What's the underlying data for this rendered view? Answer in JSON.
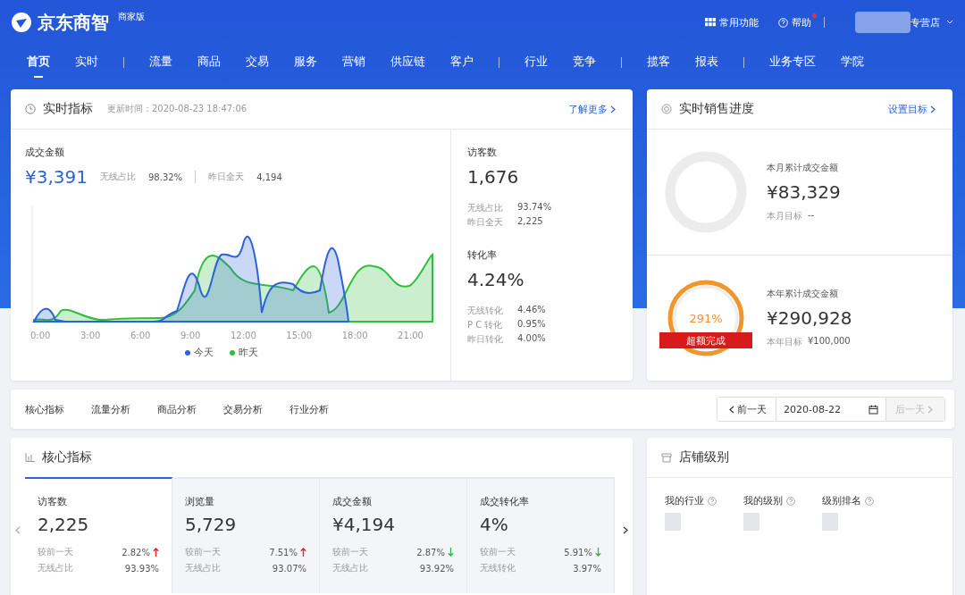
{
  "header": {
    "logo": "京东商智",
    "edition": "商家版",
    "tools": [
      {
        "kind": "apps",
        "label": "常用功能",
        "notice": false
      },
      {
        "kind": "help",
        "label": "帮助",
        "notice": true
      }
    ],
    "account_suffix": "专营店"
  },
  "nav": [
    [
      {
        "label": "首页",
        "selected": true
      },
      {
        "label": "实时",
        "selected": false
      }
    ],
    [
      {
        "label": "流量",
        "selected": false
      },
      {
        "label": "商品",
        "selected": false
      },
      {
        "label": "交易",
        "selected": false
      },
      {
        "label": "服务",
        "selected": false
      },
      {
        "label": "营销",
        "selected": false
      },
      {
        "label": "供应链",
        "selected": false
      },
      {
        "label": "客户",
        "selected": false
      }
    ],
    [
      {
        "label": "行业",
        "selected": false
      },
      {
        "label": "竞争",
        "selected": false
      }
    ],
    [
      {
        "label": "揽客",
        "selected": false
      },
      {
        "label": "报表",
        "selected": false
      }
    ],
    [
      {
        "label": "业务专区",
        "selected": false
      },
      {
        "label": "学院",
        "selected": false
      }
    ]
  ],
  "realtime": {
    "title": "实时指标",
    "updated": "更新时间：2020-08-23 18:47:06",
    "more": "了解更多",
    "sales_label": "成交金额",
    "sales_value": "¥3,391",
    "sales_stats": [
      {
        "label": "无线占比",
        "value": "98.32%"
      },
      {
        "label": "昨日全天",
        "value": "4,194"
      }
    ],
    "xticks": [
      "0:00",
      "3:00",
      "6:00",
      "9:00",
      "12:00",
      "15:00",
      "18:00",
      "21:00"
    ],
    "legend": [
      {
        "label": "今天",
        "color": "#2b63d9"
      },
      {
        "label": "昨天",
        "color": "#2fbf3b"
      }
    ],
    "side": [
      {
        "label": "访客数",
        "value": "1,676",
        "stats": [
          {
            "label": "无线占比",
            "value": "93.74%"
          },
          {
            "label": "昨日全天",
            "value": "2,225"
          }
        ]
      },
      {
        "label": "转化率",
        "value": "4.24%",
        "stats": [
          {
            "label": "无线转化",
            "value": "4.46%"
          },
          {
            "label": "P C 转化",
            "value": "0.95%"
          },
          {
            "label": "昨日转化",
            "value": "4.00%"
          }
        ]
      }
    ]
  },
  "progress": {
    "title": "实时销售进度",
    "link": "设置目标",
    "items": [
      {
        "kind": "empty",
        "label": "本月累计成交金额",
        "value": "¥83,329",
        "target_label": "本月目标",
        "target": "--"
      },
      {
        "kind": "exceeded",
        "percent": "291%",
        "ribbon": "超额完成",
        "label": "本年累计成交金额",
        "value": "¥290,928",
        "target_label": "本年目标",
        "target": "¥100,000"
      }
    ]
  },
  "analysis_tabs": [
    "核心指标",
    "流量分析",
    "商品分析",
    "交易分析",
    "行业分析"
  ],
  "date_picker": {
    "prev": "前一天",
    "date": "2020-08-22",
    "next": "后一天",
    "next_disabled": true
  },
  "core": {
    "title": "核心指标",
    "cards": [
      {
        "label": "访客数",
        "value": "2,225",
        "selected": true,
        "rows": [
          {
            "label": "较前一天",
            "value": "2.82%",
            "rising": true
          },
          {
            "label": "无线占比",
            "value": "93.93%"
          }
        ]
      },
      {
        "label": "浏览量",
        "value": "5,729",
        "selected": false,
        "rows": [
          {
            "label": "较前一天",
            "value": "7.51%",
            "rising": true
          },
          {
            "label": "无线占比",
            "value": "93.07%"
          }
        ]
      },
      {
        "label": "成交金额",
        "value": "¥4,194",
        "selected": false,
        "rows": [
          {
            "label": "较前一天",
            "value": "2.87%",
            "rising": false
          },
          {
            "label": "无线占比",
            "value": "93.92%"
          }
        ]
      },
      {
        "label": "成交转化率",
        "value": "4%",
        "selected": false,
        "rows": [
          {
            "label": "较前一天",
            "value": "5.91%",
            "rising": false
          },
          {
            "label": "无线转化",
            "value": "3.97%"
          }
        ]
      }
    ]
  },
  "shop_level": {
    "title": "店铺级别",
    "columns": [
      "我的行业",
      "我的级别",
      "级别排名"
    ]
  }
}
